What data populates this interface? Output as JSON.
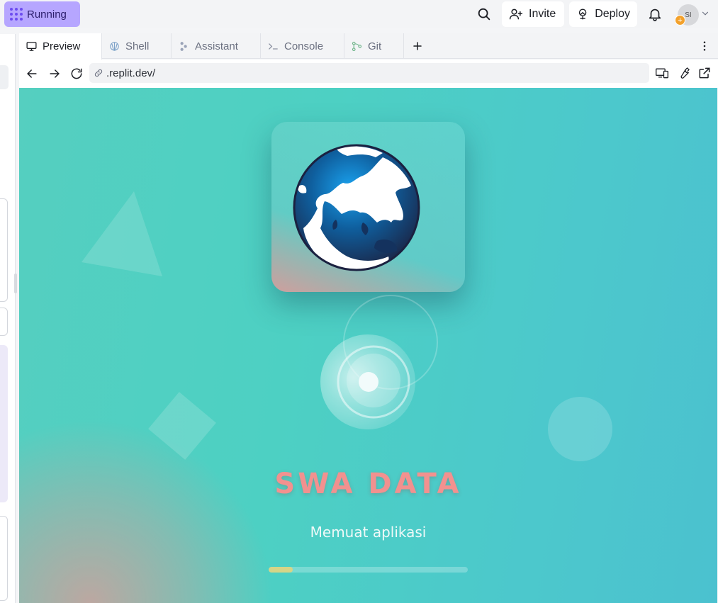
{
  "topbar": {
    "run_label": "Running",
    "invite_label": "Invite",
    "deploy_label": "Deploy",
    "avatar_initials": "SI",
    "avatar_badge": "+",
    "run_color": "#b6a6ff",
    "icons": [
      "apps-grid-icon",
      "search-icon",
      "add-user-icon",
      "deploy-icon",
      "bell-icon",
      "chevron-down-icon"
    ]
  },
  "tabs": [
    {
      "label": "Preview",
      "icon": "monitor-icon",
      "active": true
    },
    {
      "label": "Shell",
      "icon": "shell-icon",
      "active": false
    },
    {
      "label": "Assistant",
      "icon": "assistant-icon",
      "active": false
    },
    {
      "label": "Console",
      "icon": "terminal-icon",
      "active": false
    },
    {
      "label": "Git",
      "icon": "git-icon",
      "active": false
    }
  ],
  "urlbar": {
    "url": ".replit.dev/",
    "icons": [
      "back-icon",
      "forward-icon",
      "reload-icon",
      "link-icon",
      "devices-icon",
      "wrench-icon",
      "open-external-icon"
    ]
  },
  "preview": {
    "brand": "SWA DATA",
    "loading_text": "Memuat aplikasi",
    "progress": 0.12,
    "colors": {
      "background": "#4dd0c3",
      "brand": "#f2918f",
      "progress_fill": "#d6d587",
      "globe_ocean": "#1aa3f0"
    }
  }
}
